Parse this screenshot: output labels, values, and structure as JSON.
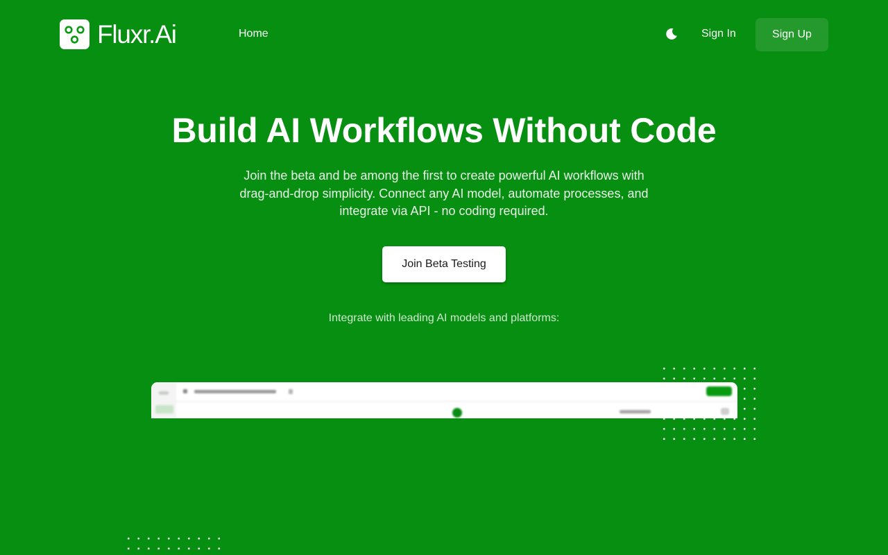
{
  "header": {
    "brand": "Fluxr.Ai",
    "nav": {
      "home": "Home"
    },
    "theme_icon": "moon-icon",
    "sign_in": "Sign In",
    "sign_up": "Sign Up"
  },
  "hero": {
    "title": "Build AI Workflows Without Code",
    "subtitle_lines": [
      "Join the beta and be among the first to create powerful AI workflows with",
      "drag-and-drop simplicity. Connect any AI model, automate processes, and",
      "integrate via API - no coding required."
    ],
    "cta": "Join Beta Testing",
    "integrations_text": "Integrate with leading AI models and platforms:"
  },
  "colors": {
    "background": "#068f10",
    "sign_up_bg": "#239a2b",
    "cta_bg": "#ffffff",
    "cta_text": "#1a1a1a"
  }
}
